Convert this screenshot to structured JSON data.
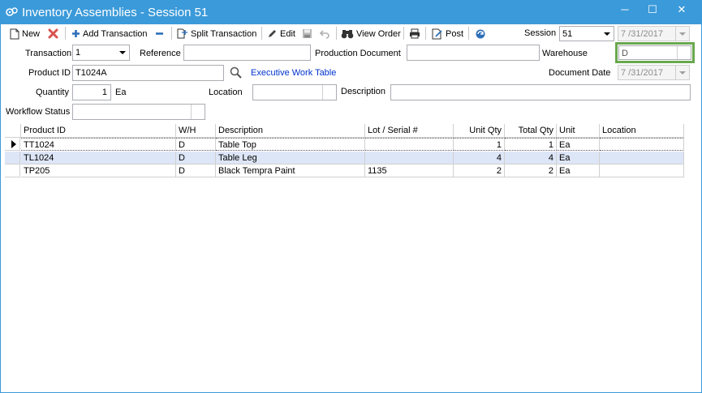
{
  "window": {
    "title": "Inventory Assemblies - Session 51",
    "minimize": "─",
    "maximize": "☐",
    "close": "✕"
  },
  "toolbar": {
    "new_label": "New",
    "add_transaction_label": "Add Transaction",
    "split_transaction_label": "Split Transaction",
    "edit_label": "Edit",
    "view_order_label": "View Order",
    "post_label": "Post",
    "session_label": "Session",
    "session_value": "51",
    "date_value": "7 /31/2017"
  },
  "form": {
    "transaction_label": "Transaction",
    "transaction_value": "1",
    "reference_label": "Reference",
    "reference_value": "",
    "production_document_label": "Production Document",
    "production_document_value": "",
    "warehouse_label": "Warehouse",
    "warehouse_value": "D",
    "product_id_label": "Product ID",
    "product_id_value": "T1024A",
    "product_name": "Executive Work Table",
    "document_date_label": "Document Date",
    "document_date_value": "7 /31/2017",
    "quantity_label": "Quantity",
    "quantity_value": "1",
    "quantity_unit": "Ea",
    "location_label": "Location",
    "location_value": "",
    "description_label": "Description",
    "description_value": "",
    "workflow_status_label": "Workflow Status",
    "workflow_status_value": ""
  },
  "grid": {
    "columns": [
      "Product ID",
      "W/H",
      "Description",
      "Lot / Serial #",
      "Unit Qty",
      "Total Qty",
      "Unit",
      "Location"
    ],
    "rows": [
      {
        "product_id": "TT1024",
        "wh": "D",
        "description": "Table Top",
        "lot": "",
        "unit_qty": "1",
        "total_qty": "1",
        "unit": "Ea",
        "location": ""
      },
      {
        "product_id": "TL1024",
        "wh": "D",
        "description": "Table Leg",
        "lot": "",
        "unit_qty": "4",
        "total_qty": "4",
        "unit": "Ea",
        "location": ""
      },
      {
        "product_id": "TP205",
        "wh": "D",
        "description": "Black Tempra Paint",
        "lot": "1135",
        "unit_qty": "2",
        "total_qty": "2",
        "unit": "Ea",
        "location": ""
      }
    ]
  },
  "colors": {
    "titlebar": "#3b9ad9",
    "selected_row": "#dde6f7",
    "warehouse_highlight": "#6aa84f",
    "link": "#0033cc"
  }
}
